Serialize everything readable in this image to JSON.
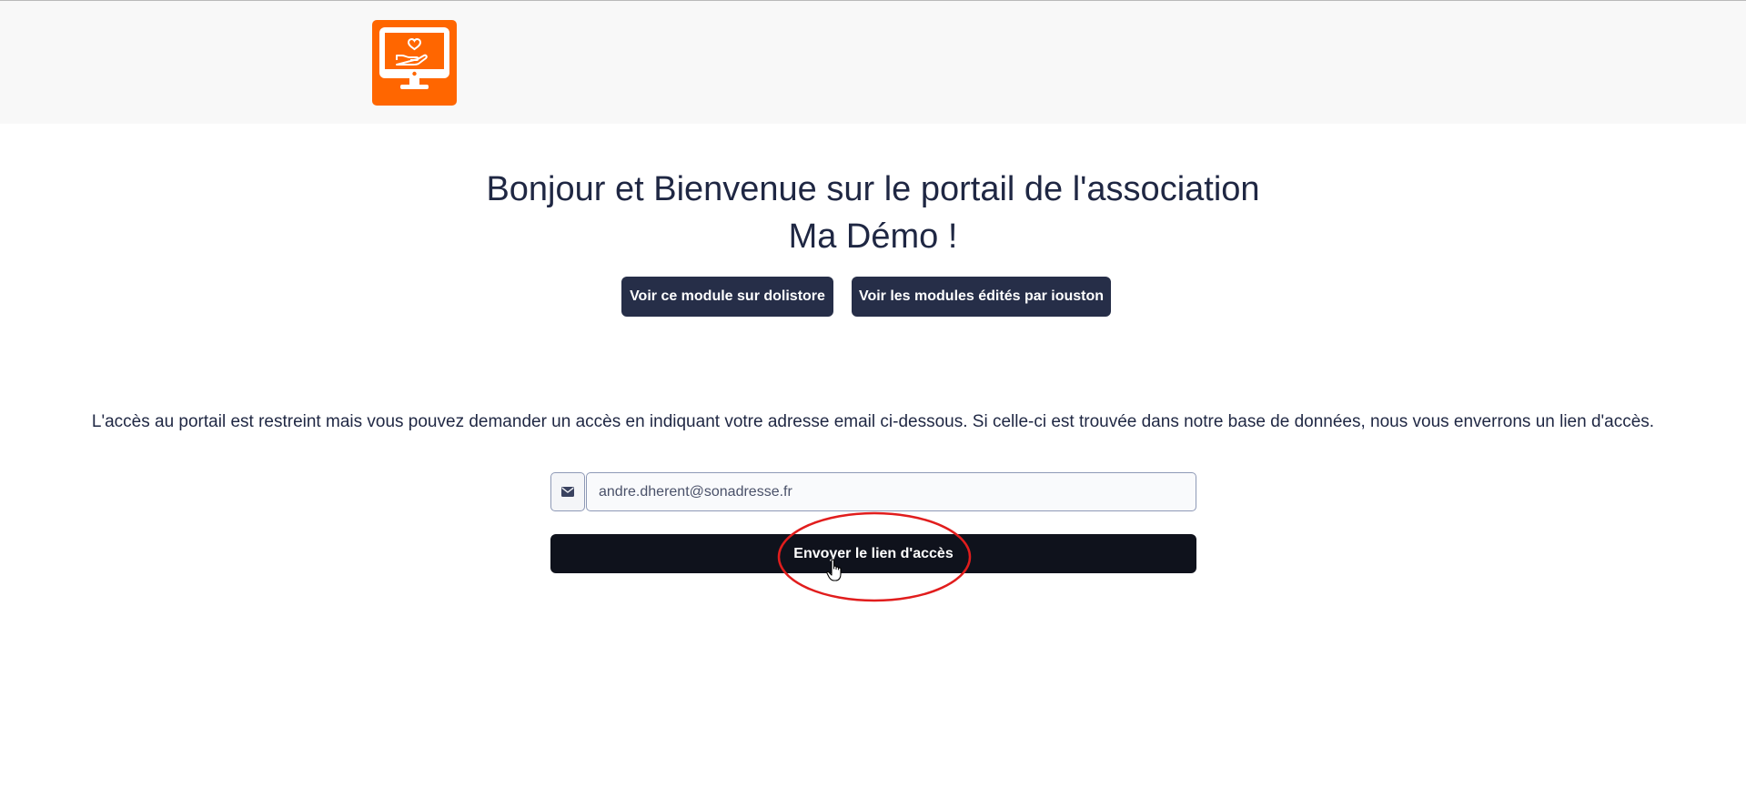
{
  "header": {
    "logo_icon": "monitor-heart-hand-icon",
    "logo_color": "#ff6600"
  },
  "main": {
    "title_line1": "Bonjour et Bienvenue sur le portail de l'association",
    "title_line2": "Ma Démo !",
    "buttons": {
      "dolistore_label": "Voir ce module sur dolistore",
      "modules_label": "Voir les modules édités par iouston"
    },
    "info_text": "L'accès au portail est restreint mais vous pouvez demander un accès en indiquant votre adresse email ci-dessous. Si celle-ci est trouvée dans notre base de données, nous vous enverrons un lien d'accès.",
    "email": {
      "icon": "envelope-icon",
      "value": "andre.dherent@sonadresse.fr"
    },
    "submit_label": "Envoyer le lien d'accès"
  },
  "colors": {
    "primary_dark": "#262e48",
    "submit_bg": "#0f121c",
    "annotation": "#e11d1d"
  }
}
